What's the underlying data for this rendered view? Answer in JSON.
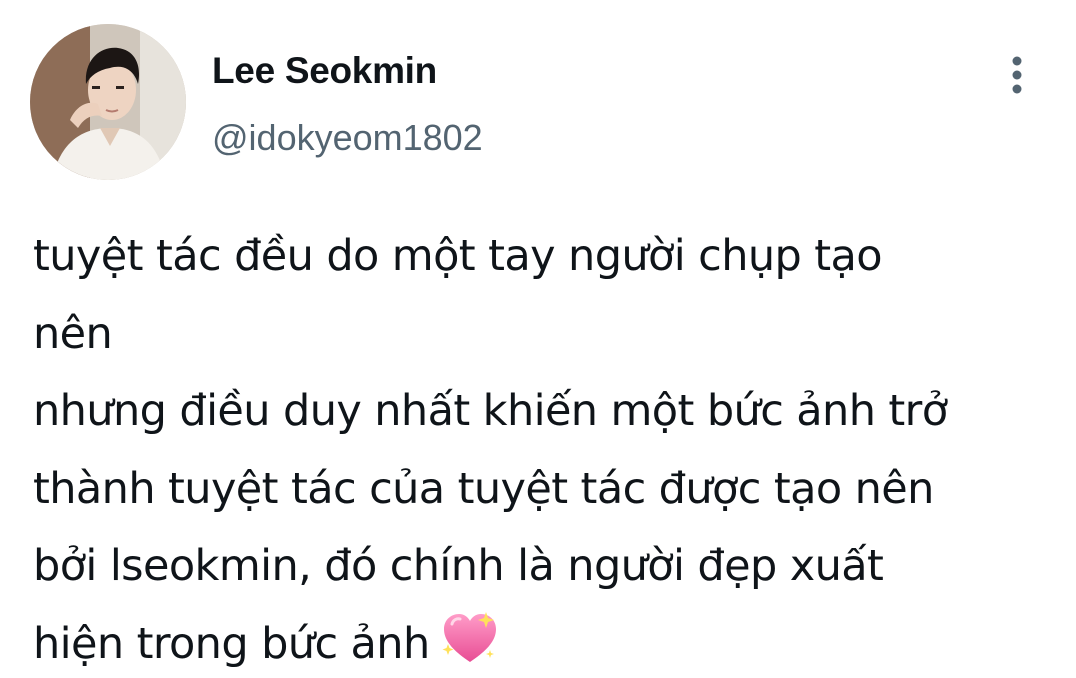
{
  "author": {
    "display_name": "Lee Seokmin",
    "handle": "@idokyeom1802",
    "avatar_icon": "profile-photo"
  },
  "header": {
    "more_icon": "more-vertical-icon"
  },
  "tweet": {
    "lines": [
      "tuyệt tác đều do một tay người chụp tạo",
      "nên",
      "nhưng điều duy nhất khiến một bức ảnh trở",
      "thành tuyệt tác của tuyệt tác được tạo nên",
      "bởi lseokmin, đó chính là người đẹp xuất",
      "hiện trong bức ảnh"
    ],
    "emoji": "sparkling-heart"
  },
  "colors": {
    "text_primary": "#0f1419",
    "text_secondary": "#536471",
    "heart": "#f06aa8"
  }
}
